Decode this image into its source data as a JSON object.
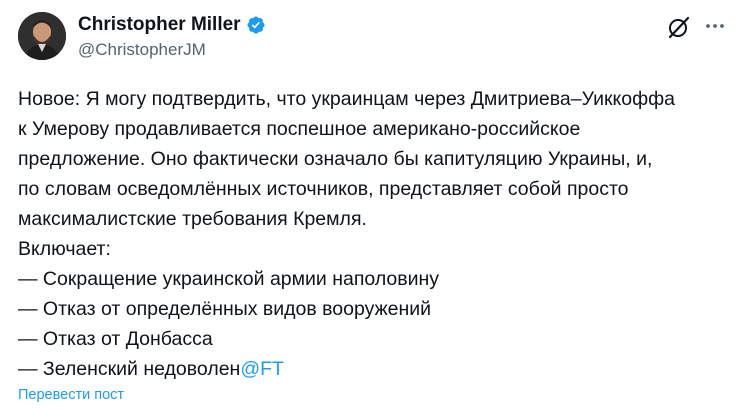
{
  "author": {
    "name": "Christopher Miller",
    "handle": "@ChristopherJM",
    "avatar_icon": "user-avatar-photo",
    "verified_icon": "verified-badge-icon",
    "verified_color": "#1d9bf0"
  },
  "header_actions": {
    "grok_icon": "grok-icon",
    "more_icon": "more-options-icon"
  },
  "tweet": {
    "lines": [
      "Новое: Я могу подтвердить, что украинцам через Дмитриева–Уиккоффа",
      "к Умерову продавливается поспешное американо-российское",
      "предложение. Оно фактически означало бы капитуляцию Украины, и,",
      "по словам осведомлённых источников, представляет собой просто",
      "максималистские требования Кремля.",
      "Включает:",
      "— Сокращение украинской армии наполовину",
      "— Отказ от определённых видов вооружений",
      "— Отказ от Донбасса"
    ],
    "last_line_text": "— Зеленский недоволен",
    "mention": "@FT"
  },
  "translate_label": "Перевести пост",
  "colors": {
    "text": "#0f1419",
    "secondary": "#536471",
    "link": "#1d9bf0"
  }
}
